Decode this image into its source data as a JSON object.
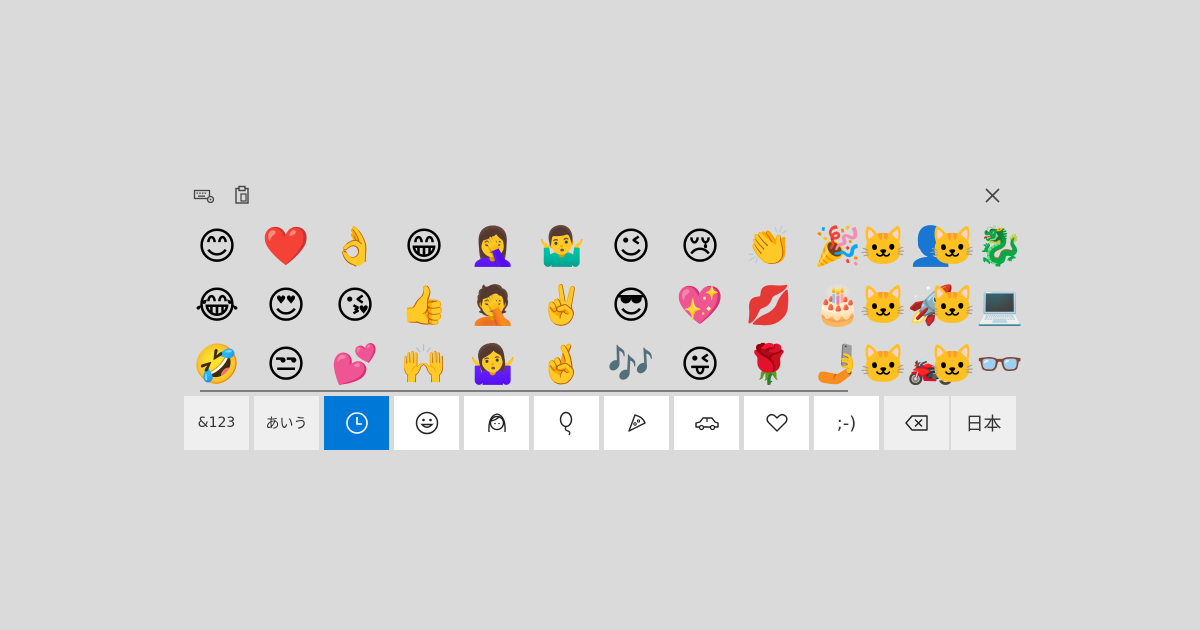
{
  "toolbar": {
    "icons": [
      "keyboard-settings-icon",
      "clipboard-icon",
      "close-icon"
    ]
  },
  "emoji_grid": [
    [
      "😊",
      "❤️",
      "👌",
      "😁",
      "🤦‍♀️",
      "🤷‍♂️",
      "😉",
      "😢",
      "👏",
      "🎉",
      "🐱‍👤",
      "🐱‍🐉"
    ],
    [
      "😂",
      "😍",
      "😘",
      "👍",
      "🤦",
      "✌️",
      "😎",
      "💖",
      "💋",
      "🎂",
      "🐱‍🚀",
      "🐱‍💻"
    ],
    [
      "🤣",
      "😒",
      "💕",
      "🙌",
      "🤷‍♀️",
      "🤞",
      "🎶",
      "😜",
      "🌹",
      "🤳",
      "🐱‍🏍",
      "🐱‍👓"
    ]
  ],
  "categories": [
    {
      "label": "&123",
      "type": "text"
    },
    {
      "label": "あいう",
      "type": "text"
    },
    {
      "icon": "clock-icon",
      "type": "icon"
    },
    {
      "icon": "smiley-icon",
      "type": "icon"
    },
    {
      "icon": "person-icon",
      "type": "icon"
    },
    {
      "icon": "balloon-icon",
      "type": "icon"
    },
    {
      "icon": "pizza-icon",
      "type": "icon"
    },
    {
      "icon": "car-icon",
      "type": "icon"
    },
    {
      "icon": "heart-icon",
      "type": "icon"
    },
    {
      "label": ";-)",
      "type": "text"
    },
    {
      "icon": "backspace-icon",
      "type": "icon"
    },
    {
      "label": "日本",
      "type": "text"
    }
  ],
  "active_category": "clock-icon",
  "colors": {
    "background": "#dadada",
    "tile": "#ffffff",
    "tile_grey": "#efefef",
    "accent": "#0078d7"
  }
}
